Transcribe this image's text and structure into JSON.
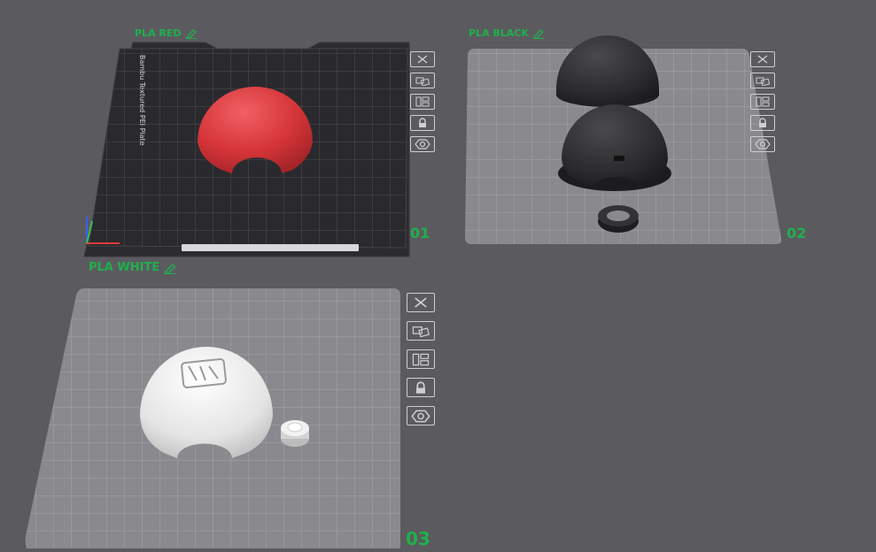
{
  "plates": [
    {
      "filament": "PLA RED",
      "number": "01",
      "bed_text": "Bambu Textured PEI Plate"
    },
    {
      "filament": "PLA BLACK",
      "number": "02"
    },
    {
      "filament": "PLA WHITE",
      "number": "03"
    }
  ],
  "toolbar_buttons": [
    "close-icon",
    "auto-arrange-icon",
    "orient-icon",
    "lock-icon",
    "eye-icon"
  ],
  "colors": {
    "background": "#5b5b5f",
    "label_green": "#1fb04c",
    "red_part": "#d9383c",
    "black_part": "#2a2a2c",
    "white_part": "#e6e6e6",
    "textured_plate": "#2a2a2e",
    "empty_plate": "#8a8a8e"
  }
}
